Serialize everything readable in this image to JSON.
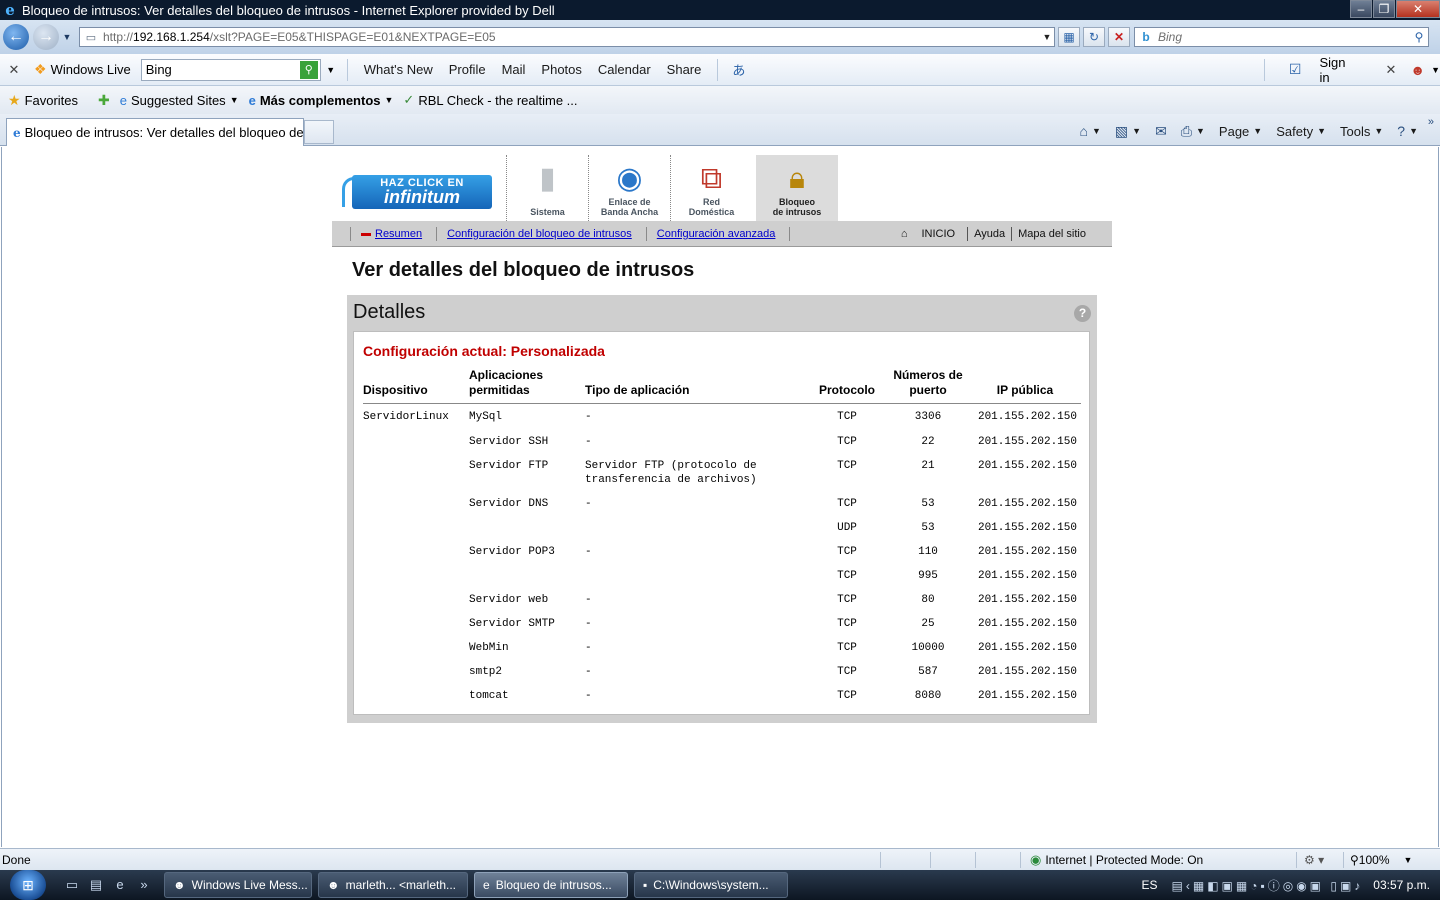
{
  "window": {
    "title": "Bloqueo de intrusos: Ver detalles del bloqueo de intrusos - Internet Explorer provided by Dell"
  },
  "address_bar": {
    "url_prefix": "http://",
    "url_host": "192.168.1.254",
    "url_path": "/xslt?PAGE=E05&THISPAGE=E01&NEXTPAGE=E05",
    "search_placeholder": "Bing"
  },
  "live_toolbar": {
    "brand": "Windows Live",
    "search_value": "Bing",
    "links": [
      "What's New",
      "Profile",
      "Mail",
      "Photos",
      "Calendar",
      "Share"
    ],
    "sign_in": "Sign in"
  },
  "favorites_bar": {
    "favorites_label": "Favorites",
    "items": [
      {
        "label": "Suggested Sites",
        "has_dropdown": true
      },
      {
        "label": "Más complementos",
        "has_dropdown": true,
        "bold": true
      },
      {
        "label": "RBL Check - the realtime ...",
        "has_dropdown": false
      }
    ]
  },
  "tab": {
    "title": "Bloqueo de intrusos: Ver detalles del bloqueo de i..."
  },
  "command_bar": {
    "page": "Page",
    "safety": "Safety",
    "tools": "Tools"
  },
  "router": {
    "logo_line1": "HAZ CLICK EN",
    "logo_line2": "infinitum",
    "nav": [
      {
        "label": "Sistema",
        "icon": "server-icon"
      },
      {
        "label": "Enlace de\nBanda Ancha",
        "icon": "globe-icon"
      },
      {
        "label": "Red\nDoméstica",
        "icon": "network-icon"
      },
      {
        "label": "Bloqueo\nde intrusos",
        "icon": "padlock-icon",
        "active": true
      }
    ],
    "subnav": {
      "resumen": "Resumen",
      "config_bloqueo": "Configuración del bloqueo de intrusos",
      "config_avanzada": "Configuración avanzada",
      "inicio": "INICIO",
      "ayuda": "Ayuda",
      "mapa": "Mapa del sitio"
    }
  },
  "page": {
    "title": "Ver detalles del bloqueo de intrusos",
    "panel_title": "Detalles",
    "current_config": "Configuración actual: Personalizada"
  },
  "table": {
    "headers": {
      "dispositivo": "Dispositivo",
      "aplicaciones": "Aplicaciones permitidas",
      "tipo": "Tipo de aplicación",
      "protocolo": "Protocolo",
      "puerto": "Números de puerto",
      "ip": "IP pública"
    },
    "rows": [
      {
        "device": "ServidorLinux",
        "app": "MySql",
        "type": "-",
        "proto": "TCP",
        "port": "3306",
        "ip": "201.155.202.150"
      },
      {
        "device": "",
        "app": "Servidor SSH",
        "type": "-",
        "proto": "TCP",
        "port": "22",
        "ip": "201.155.202.150"
      },
      {
        "device": "",
        "app": "Servidor FTP",
        "type": "Servidor FTP (protocolo de transferencia de archivos)",
        "proto": "TCP",
        "port": "21",
        "ip": "201.155.202.150"
      },
      {
        "device": "",
        "app": "Servidor DNS",
        "type": "-",
        "proto": "TCP",
        "port": "53",
        "ip": "201.155.202.150"
      },
      {
        "device": "",
        "app": "",
        "type": "",
        "proto": "UDP",
        "port": "53",
        "ip": "201.155.202.150"
      },
      {
        "device": "",
        "app": "Servidor POP3",
        "type": "-",
        "proto": "TCP",
        "port": "110",
        "ip": "201.155.202.150"
      },
      {
        "device": "",
        "app": "",
        "type": "",
        "proto": "TCP",
        "port": "995",
        "ip": "201.155.202.150"
      },
      {
        "device": "",
        "app": "Servidor web",
        "type": "-",
        "proto": "TCP",
        "port": "80",
        "ip": "201.155.202.150"
      },
      {
        "device": "",
        "app": "Servidor SMTP",
        "type": "-",
        "proto": "TCP",
        "port": "25",
        "ip": "201.155.202.150"
      },
      {
        "device": "",
        "app": "WebMin",
        "type": "-",
        "proto": "TCP",
        "port": "10000",
        "ip": "201.155.202.150"
      },
      {
        "device": "",
        "app": "smtp2",
        "type": "-",
        "proto": "TCP",
        "port": "587",
        "ip": "201.155.202.150"
      },
      {
        "device": "",
        "app": "tomcat",
        "type": "-",
        "proto": "TCP",
        "port": "8080",
        "ip": "201.155.202.150"
      }
    ]
  },
  "status_bar": {
    "status": "Done",
    "zone": "Internet | Protected Mode: On",
    "zoom": "100%"
  },
  "taskbar": {
    "buttons": [
      {
        "label": "Windows Live Mess...",
        "icon": "messenger-icon"
      },
      {
        "label": "marleth... <marleth...",
        "icon": "chat-icon"
      },
      {
        "label": "Bloqueo de intrusos...",
        "icon": "ie-icon",
        "active": true
      },
      {
        "label": "C:\\Windows\\system...",
        "icon": "cmd-icon"
      }
    ],
    "language": "ES",
    "clock": "03:57 p.m."
  }
}
